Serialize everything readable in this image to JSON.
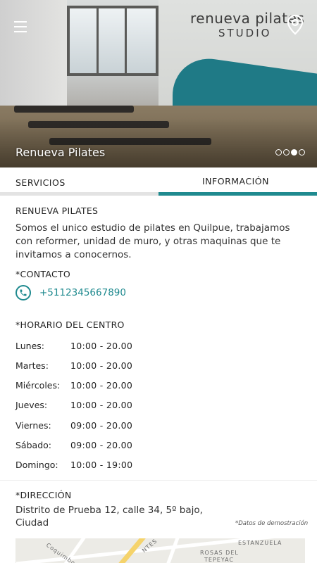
{
  "hero": {
    "title": "Renueva Pilates",
    "logo_main": "renueva pilates",
    "logo_sub": "STUDIO",
    "slides": 3,
    "active_slide": 2
  },
  "icons": {
    "menu": "hamburger-menu-icon",
    "location": "map-pin-icon",
    "phone": "phone-icon"
  },
  "colors": {
    "accent": "#1f8a8f",
    "tab_inactive": "#e3e3e3"
  },
  "tabs": [
    {
      "label": "SERVICIOS",
      "active": false
    },
    {
      "label": "INFORMACIÓN",
      "active": true
    }
  ],
  "info": {
    "heading": "RENUEVA PILATES",
    "description": "Somos el unico estudio de pilates en Quilpue, trabajamos con reformer, unidad de muro, y otras maquinas que te invitamos a conocernos.",
    "contact_heading": "*CONTACTO",
    "phone": "+5112345667890",
    "schedule_heading": "*HORARIO DEL CENTRO",
    "schedule": [
      {
        "day": "Lunes:",
        "hours": "10:00 - 20.00"
      },
      {
        "day": "Martes:",
        "hours": "10:00 - 20.00"
      },
      {
        "day": "Miércoles:",
        "hours": "10:00 - 20.00"
      },
      {
        "day": "Jueves:",
        "hours": "10:00 - 20.00"
      },
      {
        "day": "Viernes:",
        "hours": "09:00 - 20.00"
      },
      {
        "day": "Sábado:",
        "hours": "09:00 - 20.00"
      },
      {
        "day": "Domingo:",
        "hours": "10:00 - 19:00"
      }
    ],
    "address_heading": "*DIRECCIÓN",
    "address": "Distrito de Prueba 12, calle 34, 5º bajo, Ciudad",
    "demo_note": "*Datos de demostración"
  },
  "map": {
    "labels": [
      "ESTANZUELA",
      "ROSAS DEL",
      "TEPEYAC",
      "Coquimbo",
      "NTES"
    ]
  }
}
